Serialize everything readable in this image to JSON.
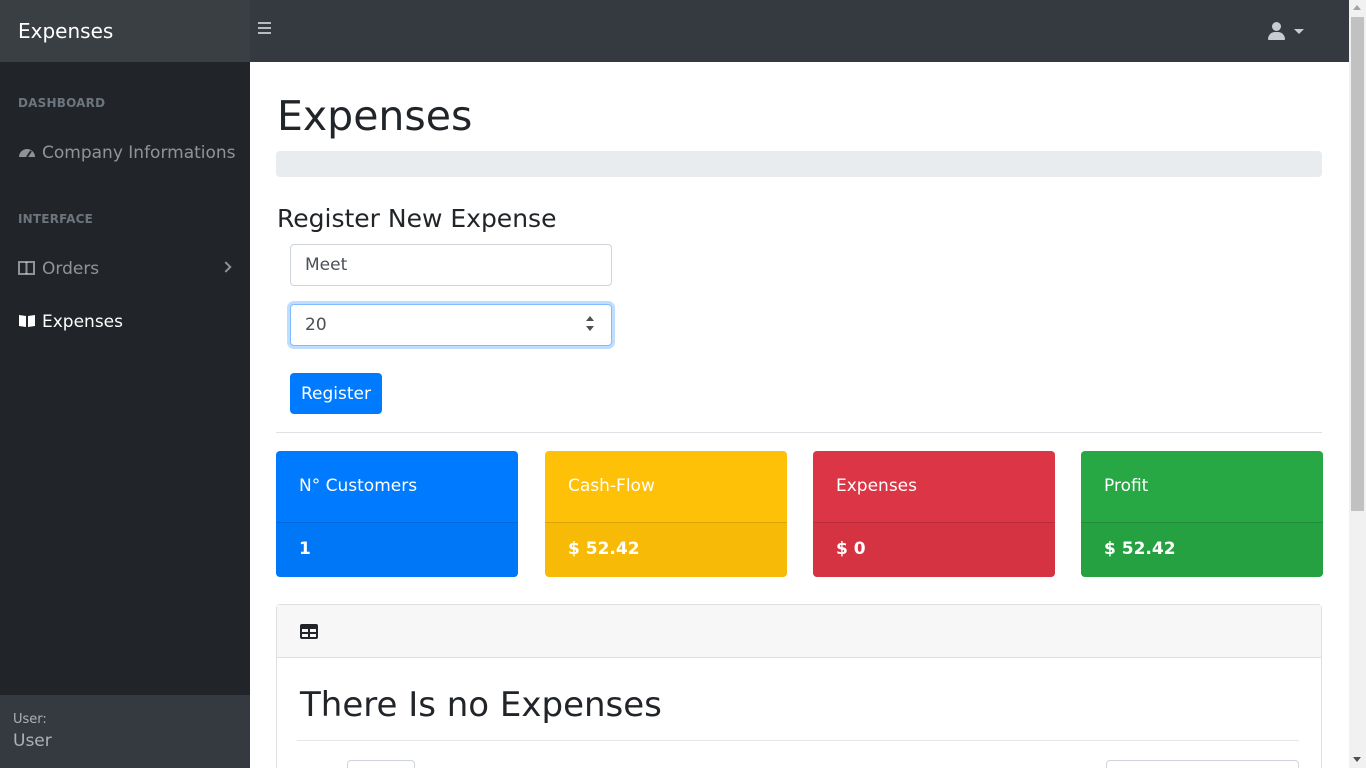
{
  "brand": "Expenses",
  "sidebar": {
    "dashboard_heading": "DASHBOARD",
    "interface_heading": "INTERFACE",
    "items": [
      {
        "label": "Company Informations"
      },
      {
        "label": "Orders"
      },
      {
        "label": "Expenses"
      }
    ],
    "footer": {
      "label": "User:",
      "value": "User"
    }
  },
  "main": {
    "page_title": "Expenses",
    "form": {
      "title": "Register New Expense",
      "name_value": "Meet",
      "amount_value": "20",
      "submit_label": "Register"
    },
    "cards": [
      {
        "title": "N° Customers",
        "value": "1",
        "color": "#007bff"
      },
      {
        "title": "Cash-Flow",
        "value": "$ 52.42",
        "color": "#ffc107"
      },
      {
        "title": "Expenses",
        "value": "$ 0",
        "color": "#dc3545"
      },
      {
        "title": "Profit",
        "value": "$ 52.42",
        "color": "#28a745"
      }
    ],
    "table": {
      "empty_message": "There Is no Expenses"
    }
  }
}
